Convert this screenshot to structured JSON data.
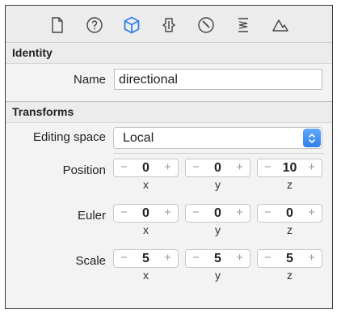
{
  "toolbar": {
    "icons": [
      "file-icon",
      "help-icon",
      "cube-icon",
      "node-icon",
      "material-icon",
      "physics-icon",
      "scene-icon"
    ],
    "accent": "#2f7fe8"
  },
  "identity": {
    "header": "Identity",
    "name_label": "Name",
    "name_value": "directional"
  },
  "transforms": {
    "header": "Transforms",
    "editing_space_label": "Editing space",
    "editing_space_value": "Local",
    "position": {
      "label": "Position",
      "x": "0",
      "y": "0",
      "z": "10"
    },
    "euler": {
      "label": "Euler",
      "x": "0",
      "y": "0",
      "z": "0"
    },
    "scale": {
      "label": "Scale",
      "x": "5",
      "y": "5",
      "z": "5"
    },
    "axes": {
      "x": "x",
      "y": "y",
      "z": "z"
    },
    "minus": "−",
    "plus": "+"
  }
}
